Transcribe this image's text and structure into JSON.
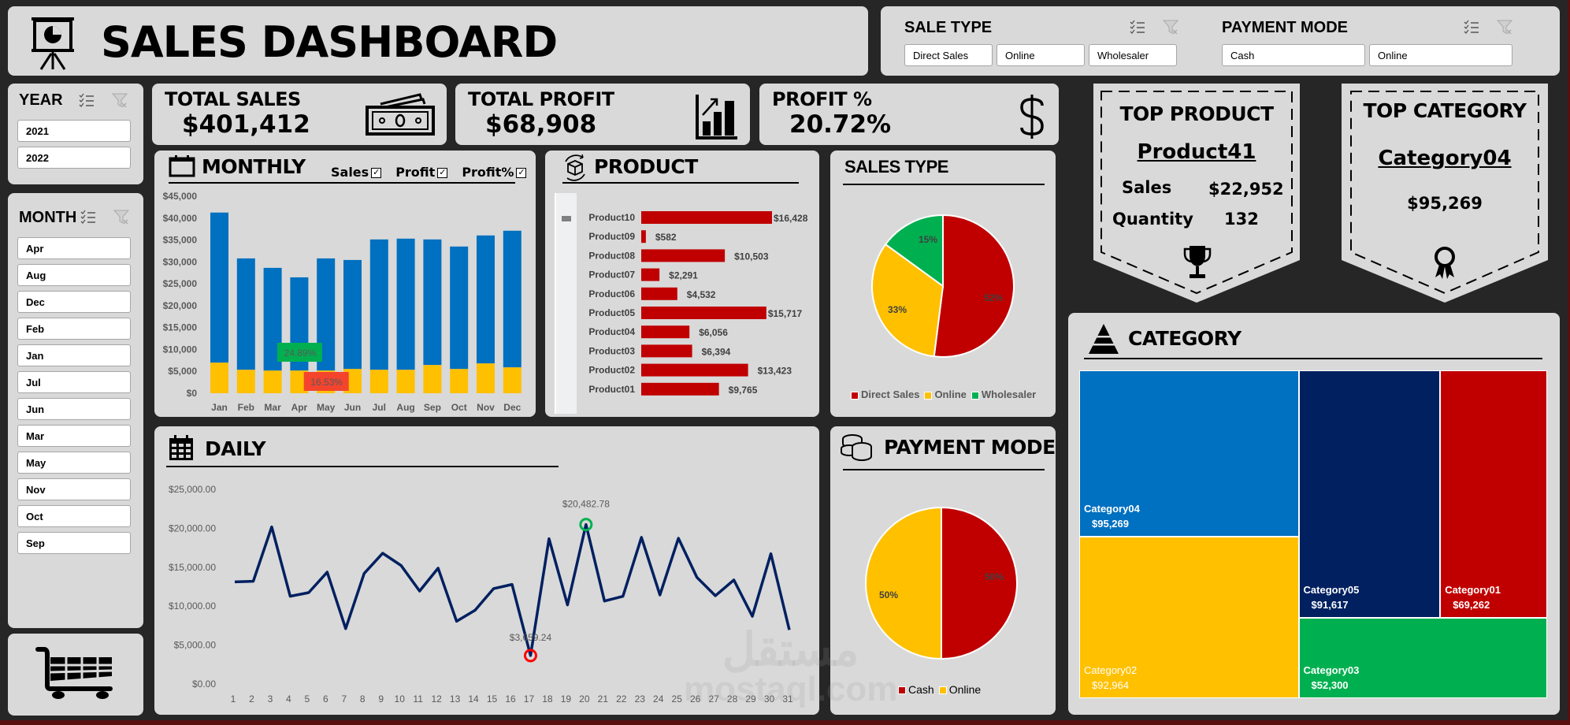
{
  "header": {
    "title": "SALES DASHBOARD",
    "icon": "presentation-chart-icon"
  },
  "filters": {
    "sale_type": {
      "label": "SALE TYPE",
      "options": [
        "Direct Sales",
        "Online",
        "Wholesaler"
      ]
    },
    "payment_mode": {
      "label": "PAYMENT MODE",
      "options": [
        "Cash",
        "Online"
      ]
    }
  },
  "sidebar": {
    "year": {
      "label": "YEAR",
      "options": [
        "2021",
        "2022"
      ]
    },
    "month": {
      "label": "MONTH",
      "options": [
        "Apr",
        "Aug",
        "Dec",
        "Feb",
        "Jan",
        "Jul",
        "Jun",
        "Mar",
        "May",
        "Nov",
        "Oct",
        "Sep"
      ]
    },
    "cart_icon": "shopping-cart-icon"
  },
  "kpis": {
    "total_sales": {
      "label": "TOTAL SALES",
      "value": "$401,412",
      "icon": "cash-icon"
    },
    "total_profit": {
      "label": "TOTAL PROFIT",
      "value": "$68,908",
      "icon": "growth-chart-icon"
    },
    "profit_pct": {
      "label": "PROFIT %",
      "value": "20.72%",
      "icon": "dollar-icon"
    }
  },
  "top_product": {
    "title": "TOP PRODUCT",
    "name": "Product41",
    "sales_label": "Sales",
    "sales_value": "$22,952",
    "qty_label": "Quantity",
    "qty_value": "132"
  },
  "top_category": {
    "title": "TOP CATEGORY",
    "name": "Category04",
    "value": "$95,269"
  },
  "colors": {
    "blue": "#0070c0",
    "yellow": "#ffc000",
    "red": "#c00000",
    "green": "#00b050",
    "navy": "#002060",
    "panel": "#d9d9d9",
    "bg": "#262626"
  },
  "watermark": {
    "arabic": "مستقل",
    "latin": "mostaql.com"
  },
  "chart_data": [
    {
      "id": "monthly",
      "type": "bar",
      "title": "MONTHLY",
      "toggles": [
        {
          "label": "Sales",
          "checked": true
        },
        {
          "label": "Profit",
          "checked": true
        },
        {
          "label": "Profit%",
          "checked": true
        }
      ],
      "categories": [
        "Jan",
        "Feb",
        "Mar",
        "Apr",
        "May",
        "Jun",
        "Jul",
        "Aug",
        "Sep",
        "Oct",
        "Nov",
        "Dec"
      ],
      "series": [
        {
          "name": "Sales",
          "color": "#0070c0",
          "values": [
            41270,
            30800,
            28640,
            26470,
            30800,
            30440,
            35130,
            35310,
            35130,
            33510,
            36040,
            37120
          ]
        },
        {
          "name": "Profit",
          "color": "#ffc000",
          "values": [
            6980,
            5350,
            5170,
            5170,
            5170,
            5530,
            5350,
            5350,
            6440,
            5530,
            6800,
            5900
          ]
        }
      ],
      "annotations": [
        {
          "month": "Apr",
          "label": "24.89%",
          "kind": "max"
        },
        {
          "month": "May",
          "label": "16.53%",
          "kind": "min"
        }
      ],
      "yticks": [
        "$0",
        "$5,000",
        "$10,000",
        "$15,000",
        "$20,000",
        "$25,000",
        "$30,000",
        "$35,000",
        "$40,000",
        "$45,000"
      ],
      "ylim": [
        0,
        45000
      ]
    },
    {
      "id": "product",
      "type": "bar",
      "orientation": "horizontal",
      "title": "PRODUCT",
      "categories": [
        "Product10",
        "Product09",
        "Product08",
        "Product07",
        "Product06",
        "Product05",
        "Product04",
        "Product03",
        "Product02",
        "Product01"
      ],
      "values": [
        16428,
        582,
        10503,
        2291,
        4532,
        15717,
        6056,
        6394,
        13423,
        9765
      ],
      "labels": [
        "$16,428",
        "$582",
        "$10,503",
        "$2,291",
        "$4,532",
        "$15,717",
        "$6,056",
        "$6,394",
        "$13,423",
        "$9,765"
      ],
      "color": "#c00000"
    },
    {
      "id": "sales_type",
      "type": "pie",
      "title": "SALES TYPE",
      "slices": [
        {
          "name": "Direct Sales",
          "value": 52,
          "label": "52%",
          "color": "#c00000"
        },
        {
          "name": "Online",
          "value": 33,
          "label": "33%",
          "color": "#ffc000"
        },
        {
          "name": "Wholesaler",
          "value": 15,
          "label": "15%",
          "color": "#00b050"
        }
      ],
      "legend": "bottom"
    },
    {
      "id": "daily",
      "type": "line",
      "title": "DAILY",
      "x": [
        1,
        2,
        3,
        4,
        5,
        6,
        7,
        8,
        9,
        10,
        11,
        12,
        13,
        14,
        15,
        16,
        17,
        18,
        19,
        20,
        21,
        22,
        23,
        24,
        25,
        26,
        27,
        28,
        29,
        30,
        31
      ],
      "values": [
        13120,
        13190,
        20180,
        11270,
        11740,
        14370,
        7120,
        14200,
        16800,
        15220,
        11940,
        14880,
        8060,
        9480,
        12250,
        12790,
        3659.24,
        18660,
        10160,
        20482.78,
        10660,
        11270,
        18830,
        11440,
        18720,
        13700,
        11340,
        13360,
        8700,
        16730,
        6950
      ],
      "max_label": {
        "day": 20,
        "label": "$20,482.78"
      },
      "min_label": {
        "day": 17,
        "label": "$3,659.24"
      },
      "yticks": [
        "$0.00",
        "$5,000.00",
        "$10,000.00",
        "$15,000.00",
        "$20,000.00",
        "$25,000.00"
      ],
      "ylim": [
        0,
        25000
      ],
      "color": "#002060"
    },
    {
      "id": "payment_mode",
      "type": "pie",
      "title": "PAYMENT MODE",
      "slices": [
        {
          "name": "Cash",
          "value": 50,
          "label": "50%",
          "color": "#c00000"
        },
        {
          "name": "Online",
          "value": 50,
          "label": "50%",
          "color": "#ffc000"
        }
      ],
      "legend": "bottom"
    },
    {
      "id": "category",
      "type": "treemap",
      "title": "CATEGORY",
      "items": [
        {
          "name": "Category04",
          "value": 95269,
          "label": "$95,269",
          "color": "#0070c0"
        },
        {
          "name": "Category02",
          "value": 92964,
          "label": "$92,964",
          "color": "#ffc000"
        },
        {
          "name": "Category05",
          "value": 91617,
          "label": "$91,617",
          "color": "#002060"
        },
        {
          "name": "Category01",
          "value": 69262,
          "label": "$69,262",
          "color": "#c00000"
        },
        {
          "name": "Category03",
          "value": 52300,
          "label": "$52,300",
          "color": "#00b050"
        }
      ]
    }
  ]
}
